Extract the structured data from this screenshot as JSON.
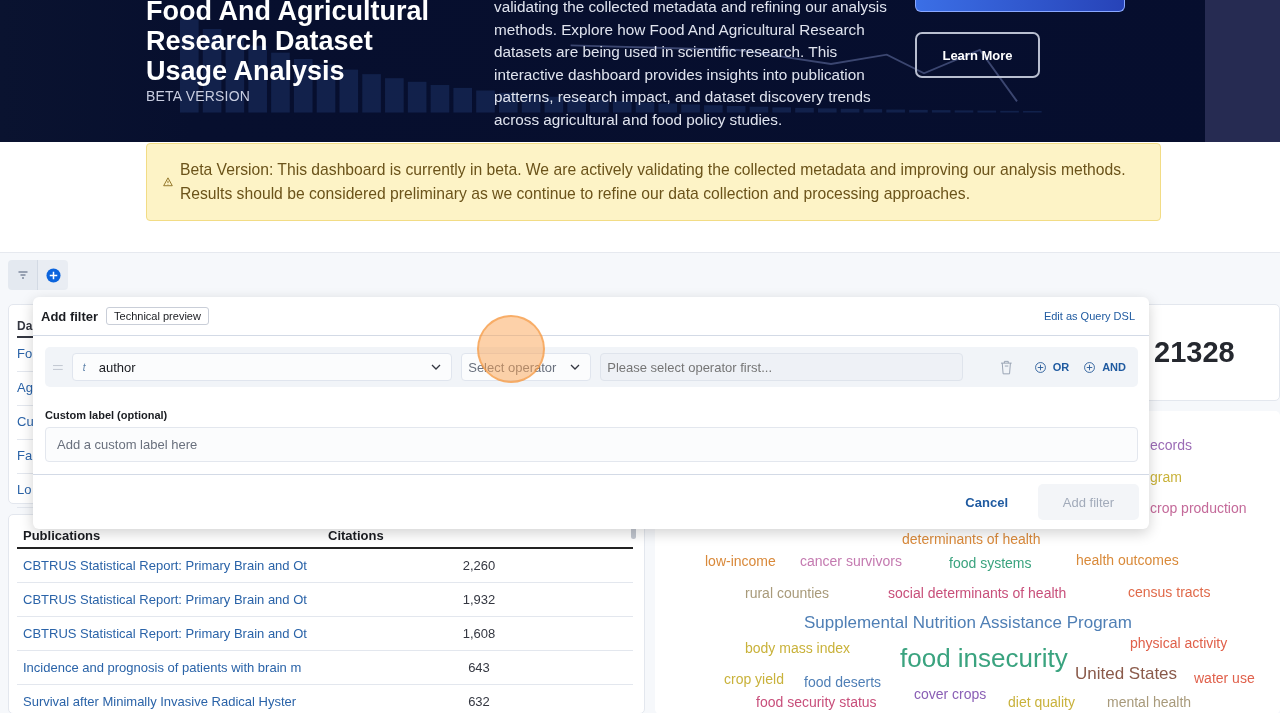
{
  "hero": {
    "title": "Food And Agricultural Research Dataset Usage Analysis",
    "subtitle": "BETA VERSION",
    "description": "validating the collected metadata and refining our analysis methods. Explore how Food And Agricultural Research datasets are being used in scientific research. This interactive dashboard provides insights into publication patterns, research impact, and dataset discovery trends across agricultural and food policy studies.",
    "buttons": [
      {
        "kind": "primary"
      },
      {
        "kind": "outline",
        "label": "Learn More"
      }
    ]
  },
  "banner": {
    "text": "Beta Version: This dashboard is currently in beta. We are actively validating the collected metadata and improving our analysis methods. Results should be considered preliminary as we continue to refine our data collection and processing approaches."
  },
  "side_panel": {
    "tab": "Da",
    "items": [
      "Fo",
      "Ag",
      "Cu",
      "Fa",
      "Lo"
    ]
  },
  "stat": {
    "value": "21328"
  },
  "table": {
    "columns": [
      "Publications",
      "Citations"
    ],
    "rows": [
      {
        "title": "CBTRUS Statistical Report: Primary Brain and Ot",
        "citations": "2,260"
      },
      {
        "title": "CBTRUS Statistical Report: Primary Brain and Ot",
        "citations": "1,932"
      },
      {
        "title": "CBTRUS Statistical Report: Primary Brain and Ot",
        "citations": "1,608"
      },
      {
        "title": "Incidence and prognosis of patients with brain m",
        "citations": "643"
      },
      {
        "title": "Survival after Minimally Invasive Radical Hyster",
        "citations": "632"
      }
    ]
  },
  "word_cloud": [
    {
      "text": "ecords",
      "color": "#9b6bb5",
      "kind": "small"
    },
    {
      "text": "gram",
      "color": "#c9b23a",
      "kind": "small"
    },
    {
      "text": "crop production",
      "color": "#c46a9a",
      "kind": "small"
    },
    {
      "text": "determinants of health",
      "color": "#d9893a",
      "kind": "small"
    },
    {
      "text": "low-income",
      "color": "#d9893a",
      "kind": "small"
    },
    {
      "text": "cancer survivors",
      "color": "#c47ab0",
      "kind": "small"
    },
    {
      "text": "food systems",
      "color": "#3aa37e",
      "kind": "small"
    },
    {
      "text": "health outcomes",
      "color": "#d98a3a",
      "kind": "small"
    },
    {
      "text": "rural counties",
      "color": "#a89a7a",
      "kind": "small"
    },
    {
      "text": "social determinants of health",
      "color": "#c84f7a",
      "kind": "small"
    },
    {
      "text": "census tracts",
      "color": "#e06a4a",
      "kind": "small"
    },
    {
      "text": "Supplemental Nutrition Assistance Program",
      "color": "#4f7fb5",
      "kind": "medium"
    },
    {
      "text": "body mass index",
      "color": "#c9b23a",
      "kind": "small"
    },
    {
      "text": "food insecurity",
      "color": "#3aa37f",
      "kind": "large"
    },
    {
      "text": "physical activity",
      "color": "#e0604a",
      "kind": "small"
    },
    {
      "text": "crop yield",
      "color": "#c9b23b",
      "kind": "small"
    },
    {
      "text": "food deserts",
      "color": "#4f7fb6",
      "kind": "small"
    },
    {
      "text": "United States",
      "color": "#8a5a4a",
      "kind": "medium"
    },
    {
      "text": "water use",
      "color": "#e0604b",
      "kind": "small"
    },
    {
      "text": "food security status",
      "color": "#c84f7b",
      "kind": "small"
    },
    {
      "text": "cover crops",
      "color": "#8a5fb5",
      "kind": "small"
    },
    {
      "text": "diet quality",
      "color": "#c9b23c",
      "kind": "small"
    },
    {
      "text": "mental health",
      "color": "#a89a7b",
      "kind": "small"
    }
  ],
  "filter_popover": {
    "title": "Add filter",
    "badge": "Technical preview",
    "query_link": "Edit as Query DSL",
    "field": {
      "type_icon": "t",
      "value": "author"
    },
    "operator": {
      "placeholder": "Select operator"
    },
    "value": {
      "placeholder": "Please select operator first...",
      "disabled": true
    },
    "or_label": "OR",
    "and_label": "AND",
    "custom_label": {
      "label": "Custom label (optional)",
      "placeholder": "Add a custom label here"
    },
    "cancel": "Cancel",
    "submit": {
      "label": "Add filter",
      "disabled": true
    }
  }
}
